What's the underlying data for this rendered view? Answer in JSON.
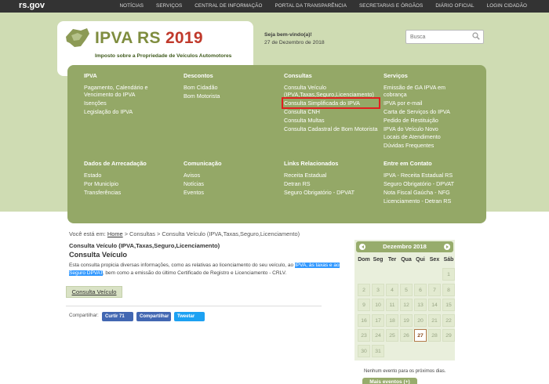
{
  "topbar": {
    "brand": "rs.gov",
    "nav": [
      "NOTÍCIAS",
      "SERVIÇOS",
      "CENTRAL DE INFORMAÇÃO",
      "PORTAL DA TRANSPARÊNCIA",
      "SECRETARIAS E ÓRGÃOS",
      "DIÁRIO OFICIAL",
      "LOGIN CIDADÃO"
    ]
  },
  "logo": {
    "ipva": "IPVA",
    "rs": "RS",
    "year": "2019",
    "subtitle": "Imposto sobre a Propriedade de Veículos Automotores"
  },
  "header": {
    "welcome": "Seja bem-vindo(a)!",
    "date": "27 de Dezembro de 2018",
    "search_placeholder": "Busca"
  },
  "menu": {
    "ipva": {
      "title": "IPVA",
      "items": [
        "Pagamento, Calendário e Vencimento do IPVA",
        "Isenções",
        "Legislação do IPVA"
      ]
    },
    "descontos": {
      "title": "Descontos",
      "items": [
        "Bom Cidadão",
        "Bom Motorista"
      ]
    },
    "consultas": {
      "title": "Consultas",
      "items": [
        "Consulta Veículo (IPVA,Taxas,Seguro,Licenciamento)",
        "Consulta Simplificada do IPVA",
        "Consulta CNH",
        "Consulta Multas",
        "Consulta Cadastral de Bom Motorista"
      ]
    },
    "servicos": {
      "title": "Serviços",
      "items": [
        "Emissão de GA IPVA em cobrança",
        "IPVA por e-mail",
        "Carta de Serviços do IPVA",
        "Pedido de Restituição",
        "IPVA do Veículo Novo",
        "Locais de Atendimento",
        "Dúvidas Frequentes"
      ]
    },
    "arrecadacao": {
      "title": "Dados de Arrecadação",
      "items": [
        "Estado",
        "Por Município",
        "Transferências"
      ]
    },
    "comunicacao": {
      "title": "Comunicação",
      "items": [
        "Avisos",
        "Notícias",
        "Eventos"
      ]
    },
    "links": {
      "title": "Links Relacionados",
      "items": [
        "Receita Estadual",
        "Detran RS",
        "Seguro Obrigatório - DPVAT"
      ]
    },
    "contato": {
      "title": "Entre em Contato",
      "items": [
        "IPVA - Receita Estadual RS",
        "Seguro Obrigatório - DPVAT",
        "Nota Fiscal Gaúcha - NFG",
        "Licenciamento - Detran RS"
      ]
    }
  },
  "content": {
    "breadcrumb_prefix": "Você está em:",
    "breadcrumb_home": "Home",
    "breadcrumb_rest": "> Consultas > Consulta Veículo (IPVA,Taxas,Seguro,Licenciamento)",
    "subtitle": "Consulta Veículo (IPVA,Taxas,Seguro,Licenciamento)",
    "title": "Consulta Veículo",
    "desc_1": "Esta consulta propicia diversas informações, como as relativas ao licenciamento do seu veículo, ao ",
    "desc_sel": "IPVA, às taxas e ao Seguro DPVAT",
    "desc_2": ", bem como a emissão do último Certificado de Registro e Licenciamento - CRLV.",
    "button": "Consulta Veículo",
    "share_label": "Compartilhar:",
    "share_fb": "Curtir 71",
    "share_fb2": "Compartilhar",
    "share_tw": "Tweetar"
  },
  "calendar": {
    "month": "Dezembro 2018",
    "dow": [
      "Dom",
      "Seg",
      "Ter",
      "Qua",
      "Qui",
      "Sex",
      "Sáb"
    ],
    "today": 27,
    "weeks": [
      [
        "",
        "",
        "",
        "",
        "",
        "",
        "1"
      ],
      [
        "2",
        "3",
        "4",
        "5",
        "6",
        "7",
        "8"
      ],
      [
        "9",
        "10",
        "11",
        "12",
        "13",
        "14",
        "15"
      ],
      [
        "16",
        "17",
        "18",
        "19",
        "20",
        "21",
        "22"
      ],
      [
        "23",
        "24",
        "25",
        "26",
        "27",
        "28",
        "29"
      ],
      [
        "30",
        "31",
        "",
        "",
        "",
        "",
        ""
      ]
    ],
    "no_events": "Nenhum evento para os próximos dias.",
    "more_button": "Mais eventos (+)"
  }
}
